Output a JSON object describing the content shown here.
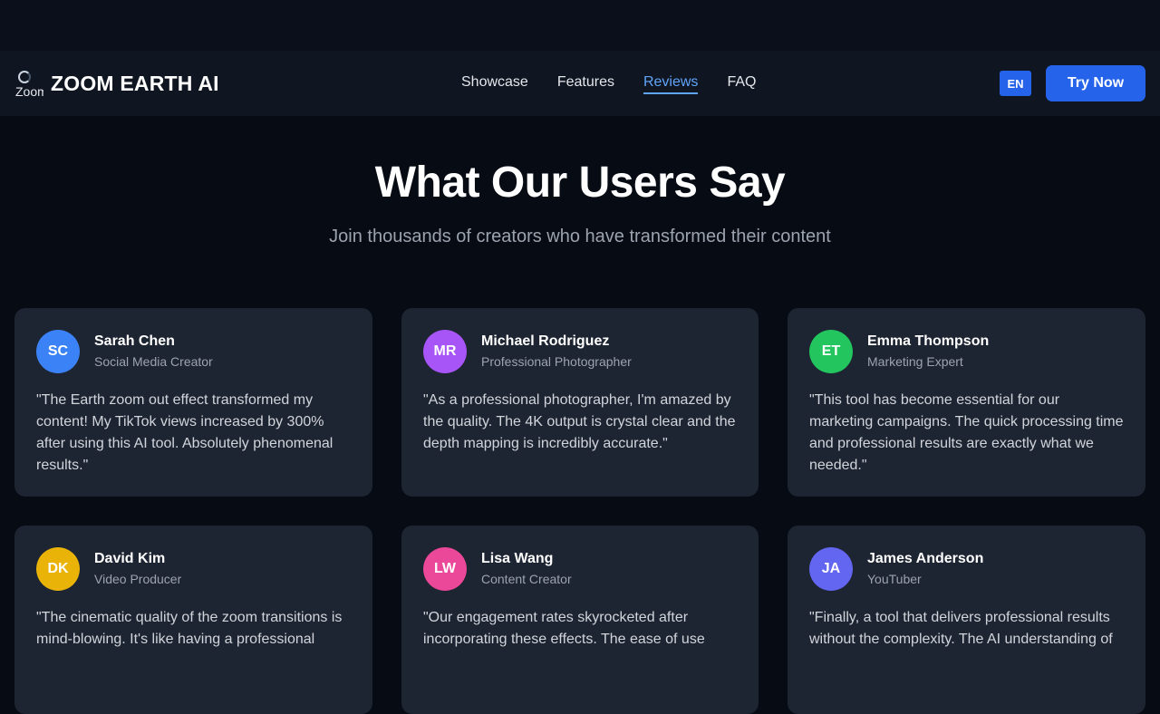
{
  "header": {
    "brand": "ZOOM EARTH AI",
    "logo_alt": "Zoom Earth AI",
    "nav": [
      {
        "label": "Showcase"
      },
      {
        "label": "Features"
      },
      {
        "label": "Reviews"
      },
      {
        "label": "FAQ"
      }
    ],
    "active_nav": "Reviews",
    "lang": "EN",
    "cta": "Try Now"
  },
  "section": {
    "title": "What Our Users Say",
    "subtitle": "Join thousands of creators who have transformed their content"
  },
  "colors": {
    "accent": "#2563eb",
    "link_active": "#60a5fa",
    "card_bg": "#1e2532"
  },
  "reviews": [
    {
      "initials": "SC",
      "name": "Sarah Chen",
      "role": "Social Media Creator",
      "color": "#3b82f6",
      "quote": "\"The Earth zoom out effect transformed my content! My TikTok views increased by 300% after using this AI tool. Absolutely phenomenal results.\""
    },
    {
      "initials": "MR",
      "name": "Michael Rodriguez",
      "role": "Professional Photographer",
      "color": "#a855f7",
      "quote": "\"As a professional photographer, I'm amazed by the quality. The 4K output is crystal clear and the depth mapping is incredibly accurate.\""
    },
    {
      "initials": "ET",
      "name": "Emma Thompson",
      "role": "Marketing Expert",
      "color": "#22c55e",
      "quote": "\"This tool has become essential for our marketing campaigns. The quick processing time and professional results are exactly what we needed.\""
    },
    {
      "initials": "DK",
      "name": "David Kim",
      "role": "Video Producer",
      "color": "#eab308",
      "quote": "\"The cinematic quality of the zoom transitions is mind-blowing. It's like having a professional"
    },
    {
      "initials": "LW",
      "name": "Lisa Wang",
      "role": "Content Creator",
      "color": "#ec4899",
      "quote": "\"Our engagement rates skyrocketed after incorporating these effects. The ease of use"
    },
    {
      "initials": "JA",
      "name": "James Anderson",
      "role": "YouTuber",
      "color": "#6366f1",
      "quote": "\"Finally, a tool that delivers professional results without the complexity. The AI understanding of"
    }
  ]
}
